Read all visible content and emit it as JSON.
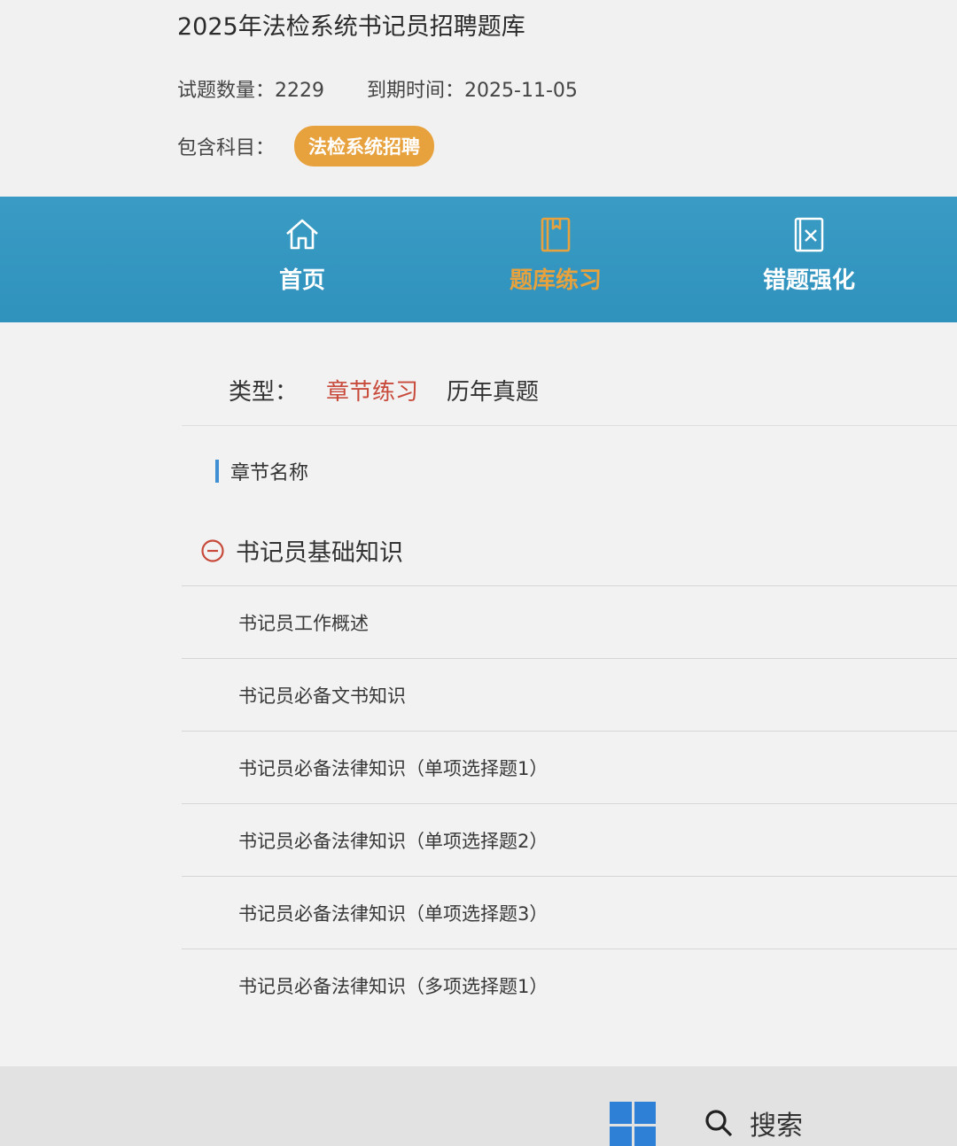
{
  "header": {
    "title": "2025年法检系统书记员招聘题库",
    "count_label": "试题数量：",
    "count_value": "2229",
    "expiry_label": "到期时间：",
    "expiry_value": "2025-11-05",
    "subjects_label": "包含科目：",
    "subject_badge": "法检系统招聘"
  },
  "nav": {
    "items": [
      {
        "label": "首页",
        "icon": "home-icon"
      },
      {
        "label": "题库练习",
        "icon": "book-icon"
      },
      {
        "label": "错题强化",
        "icon": "wrong-questions-icon"
      }
    ],
    "active_index": 1
  },
  "filter": {
    "type_label": "类型：",
    "options": [
      "章节练习",
      "历年真题"
    ],
    "active_index": 0
  },
  "section": {
    "title": "章节名称"
  },
  "group": {
    "title": "书记员基础知识",
    "icon": "collapse-minus-icon"
  },
  "chapters": [
    "书记员工作概述",
    "书记员必备文书知识",
    "书记员必备法律知识（单项选择题1）",
    "书记员必备法律知识（单项选择题2）",
    "书记员必备法律知识（单项选择题3）",
    "书记员必备法律知识（多项选择题1）"
  ],
  "taskbar": {
    "search_label": "搜索"
  },
  "colors": {
    "nav_bg": "#3a9cc4",
    "accent_orange": "#e7a23e",
    "active_red": "#c74a3b",
    "section_bar": "#3f8fd2"
  }
}
